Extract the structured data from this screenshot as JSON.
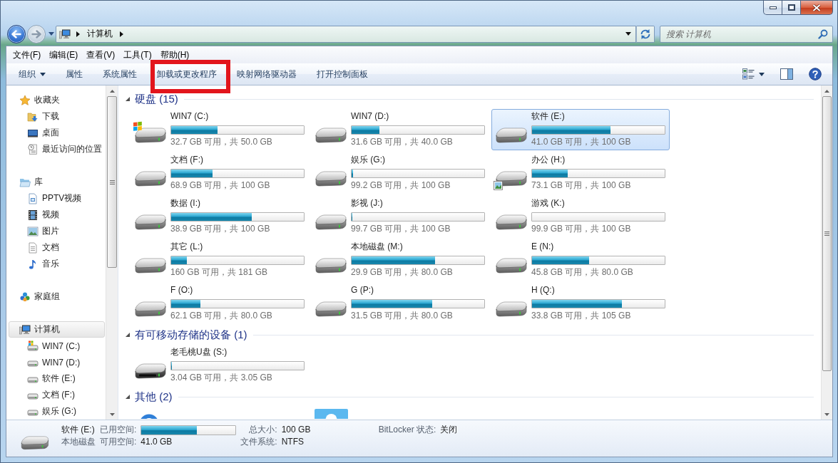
{
  "navigation": {
    "back": {
      "disabled": false
    },
    "forward": {
      "disabled": true
    }
  },
  "address_bar": {
    "crumbs": [
      "计算机"
    ]
  },
  "search": {
    "placeholder": "搜索 计算机"
  },
  "menu_bar": [
    "文件(F)",
    "编辑(E)",
    "查看(V)",
    "工具(T)",
    "帮助(H)"
  ],
  "toolbar": {
    "buttons": [
      {
        "label": "组织",
        "kind": "dropdown",
        "highlighted": false
      },
      {
        "label": "属性",
        "kind": "plain",
        "highlighted": false
      },
      {
        "label": "系统属性",
        "kind": "plain",
        "highlighted": false
      },
      {
        "label": "卸载或更改程序",
        "kind": "plain",
        "highlighted": true
      },
      {
        "label": "映射网络驱动器",
        "kind": "plain",
        "highlighted": false
      },
      {
        "label": "打开控制面板",
        "kind": "plain",
        "highlighted": false
      }
    ]
  },
  "sidebar": {
    "groups": [
      {
        "label": "收藏夹",
        "kind": "favorites",
        "selected": false,
        "children": [
          {
            "label": "下载",
            "kind": "downloads",
            "selected": false
          },
          {
            "label": "桌面",
            "kind": "desktop",
            "selected": false
          },
          {
            "label": "最近访问的位置",
            "kind": "recent",
            "selected": false
          }
        ]
      },
      {
        "label": "库",
        "kind": "library",
        "selected": false,
        "children": [
          {
            "label": "PPTV视频",
            "kind": "pptv",
            "selected": false
          },
          {
            "label": "视频",
            "kind": "videos",
            "selected": false
          },
          {
            "label": "图片",
            "kind": "pictures",
            "selected": false
          },
          {
            "label": "文档",
            "kind": "documents",
            "selected": false
          },
          {
            "label": "音乐",
            "kind": "music",
            "selected": false
          }
        ]
      },
      {
        "label": "家庭组",
        "kind": "homegroup",
        "selected": false
      },
      {
        "label": "计算机",
        "kind": "computer",
        "selected": true,
        "children": [
          {
            "label": "WIN7 (C:)",
            "kind": "system_drive",
            "selected": false
          },
          {
            "label": "WIN7 (D:)",
            "kind": "drive",
            "selected": false
          },
          {
            "label": "软件 (E:)",
            "kind": "drive",
            "selected": false
          },
          {
            "label": "文档 (F:)",
            "kind": "drive",
            "selected": false
          },
          {
            "label": "娱乐 (G:)",
            "kind": "drive",
            "selected": false
          }
        ]
      }
    ]
  },
  "content": {
    "groups": [
      {
        "title": "硬盘 (15)",
        "expanded": true,
        "items": [
          {
            "name": "WIN7 (C:)",
            "kind": "system",
            "level": 0.35,
            "space": "32.7 GB 可用，共 50.0 GB",
            "selected": false
          },
          {
            "name": "WIN7 (D:)",
            "kind": "disk",
            "level": 0.21,
            "space": "31.6 GB 可用，共 40.0 GB",
            "selected": false
          },
          {
            "name": "软件 (E:)",
            "kind": "disk",
            "level": 0.59,
            "space": "41.0 GB 可用，共 100 GB",
            "selected": true
          },
          {
            "name": "文档 (F:)",
            "kind": "disk",
            "level": 0.31,
            "space": "68.9 GB 可用，共 100 GB",
            "selected": false
          },
          {
            "name": "娱乐 (G:)",
            "kind": "disk",
            "level": 0.01,
            "space": "99.2 GB 可用，共 100 GB",
            "selected": false
          },
          {
            "name": "办公 (H:)",
            "kind": "badged",
            "level": 0.27,
            "space": "73.1 GB 可用，共 100 GB",
            "selected": false
          },
          {
            "name": "数据 (I:)",
            "kind": "disk",
            "level": 0.61,
            "space": "38.9 GB 可用，共 100 GB",
            "selected": false
          },
          {
            "name": "影视 (J:)",
            "kind": "disk",
            "level": 0.003,
            "space": "99.7 GB 可用，共 100 GB",
            "selected": false
          },
          {
            "name": "游戏 (K:)",
            "kind": "disk",
            "level": 0.001,
            "space": "99.9 GB 可用，共 100 GB",
            "selected": false
          },
          {
            "name": "其它 (L:)",
            "kind": "disk",
            "level": 0.12,
            "space": "160 GB 可用，共 181 GB",
            "selected": false
          },
          {
            "name": "本地磁盘 (M:)",
            "kind": "disk",
            "level": 0.63,
            "space": "29.9 GB 可用，共 80.0 GB",
            "selected": false
          },
          {
            "name": "E (N:)",
            "kind": "disk",
            "level": 0.43,
            "space": "45.8 GB 可用，共 80.0 GB",
            "selected": false
          },
          {
            "name": "F (O:)",
            "kind": "disk",
            "level": 0.22,
            "space": "62.1 GB 可用，共 80.0 GB",
            "selected": false
          },
          {
            "name": "G (P:)",
            "kind": "disk",
            "level": 0.61,
            "space": "31.5 GB 可用，共 80.0 GB",
            "selected": false
          },
          {
            "name": "H (Q:)",
            "kind": "disk",
            "level": 0.68,
            "space": "33.8 GB 可用，共 105 GB",
            "selected": false
          }
        ]
      },
      {
        "title": "有可移动存储的设备 (1)",
        "expanded": true,
        "items": [
          {
            "name": "老毛桃U盘 (S:)",
            "kind": "removable",
            "level": 0.003,
            "space": "3.04 GB 可用，共 3.05 GB",
            "selected": false
          }
        ]
      },
      {
        "title": "其他 (2)",
        "expanded": true,
        "items": [
          {
            "kind": "round_app"
          },
          {
            "kind": "tile_app"
          }
        ]
      }
    ]
  },
  "details_pane": {
    "kind": "disk",
    "name": "软件 (E:)",
    "type": "本地磁盘",
    "used": {
      "label": "已用空间:",
      "level": 0.59
    },
    "free": {
      "label": "可用空间:",
      "value": "41.0 GB"
    },
    "properties": [
      {
        "label": "总大小:",
        "value": "100 GB"
      },
      {
        "label": "文件系统:",
        "value": "NTFS"
      },
      {
        "label": "BitLocker 状态:",
        "value": "关闭"
      }
    ]
  }
}
